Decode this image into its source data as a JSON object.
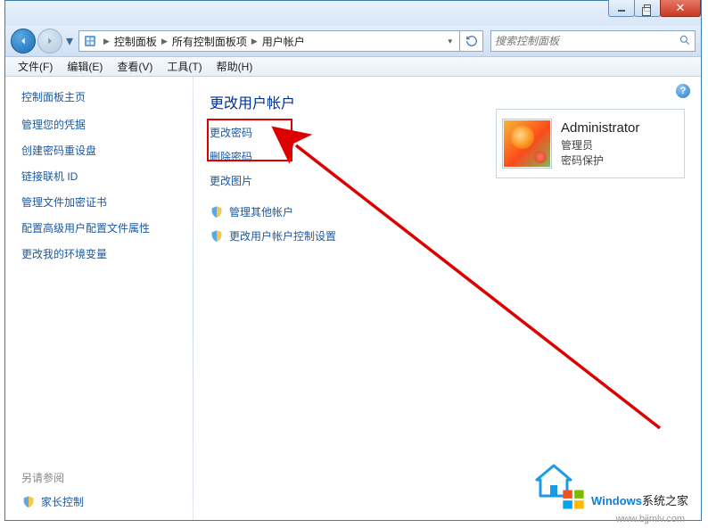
{
  "breadcrumb": {
    "root_icon": "control-panel-icon",
    "items": [
      "控制面板",
      "所有控制面板项",
      "用户帐户"
    ]
  },
  "search": {
    "placeholder": "搜索控制面板"
  },
  "menubar": {
    "file": "文件(F)",
    "edit": "编辑(E)",
    "view": "查看(V)",
    "tools": "工具(T)",
    "help": "帮助(H)"
  },
  "sidebar": {
    "home": "控制面板主页",
    "links": [
      "管理您的凭据",
      "创建密码重设盘",
      "链接联机 ID",
      "管理文件加密证书",
      "配置高级用户配置文件属性",
      "更改我的环境变量"
    ],
    "see_also": "另请参阅",
    "parental": "家长控制"
  },
  "main": {
    "title": "更改用户帐户",
    "change_password": "更改密码",
    "delete_password": "删除密码",
    "change_picture": "更改图片",
    "manage_other": "管理其他帐户",
    "uac_settings": "更改用户帐户控制设置"
  },
  "account": {
    "name": "Administrator",
    "type": "管理员",
    "password_status": "密码保护"
  },
  "watermark": {
    "brand": "Windows",
    "brand_cn": "系统之家",
    "url": "www.bjjmlv.com"
  },
  "help_glyph": "?"
}
